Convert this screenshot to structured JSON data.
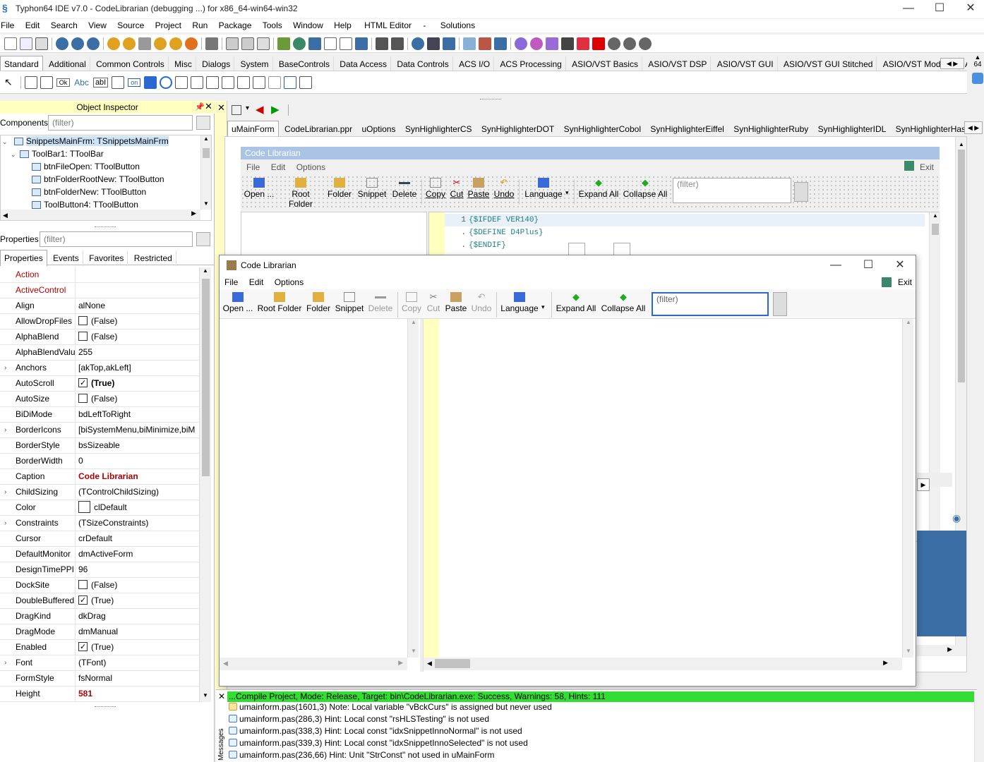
{
  "window": {
    "title": "Typhon64 IDE v7.0 - CodeLibrarian (debugging ...) for x86_64-win64-win32",
    "controls": [
      "—",
      "☐",
      "✕"
    ]
  },
  "mainmenu": [
    "File",
    "Edit",
    "Search",
    "View",
    "Source",
    "Project",
    "Run",
    "Package",
    "Tools",
    "Window",
    "Help",
    "HTML Editor",
    "-",
    "Solutions"
  ],
  "palette_tabs": [
    "Standard",
    "Additional",
    "Common Controls",
    "Misc",
    "Dialogs",
    "System",
    "BaseControls",
    "Data Access",
    "Data Controls",
    "ACS I/O",
    "ACS Processing",
    "ASIO/VST Basics",
    "ASIO/VST DSP",
    "ASIO/VST GUI",
    "ASIO/VST GUI Stitched",
    "ASIO/VST Modular",
    "Abbrevi..."
  ],
  "palette_icons": {
    "ok": "Ok",
    "abc": "Abc",
    "abl": "abI",
    "on": "on"
  },
  "palette_side": {
    "label": "64"
  },
  "object_inspector": {
    "title": "Object Inspector",
    "components_label": "Components",
    "filter_placeholder": "(filter)",
    "tree": [
      {
        "label": "SnippetsMainFrm: TSnippetsMainFrm",
        "level": 0
      },
      {
        "label": "ToolBar1: TToolBar",
        "level": 1
      },
      {
        "label": "btnFileOpen: TToolButton",
        "level": 2
      },
      {
        "label": "btnFolderRootNew: TToolButton",
        "level": 2
      },
      {
        "label": "btnFolderNew: TToolButton",
        "level": 2
      },
      {
        "label": "ToolButton4: TToolButton",
        "level": 2
      }
    ],
    "properties_label": "Properties",
    "prop_tabs": [
      "Properties",
      "Events",
      "Favorites",
      "Restricted"
    ],
    "props": [
      {
        "name": "Action",
        "value": "",
        "red": true
      },
      {
        "name": "ActiveControl",
        "value": "",
        "red": true
      },
      {
        "name": "Align",
        "value": "alNone"
      },
      {
        "name": "AllowDropFiles",
        "value": "(False)",
        "check": "off"
      },
      {
        "name": "AlphaBlend",
        "value": "(False)",
        "check": "off"
      },
      {
        "name": "AlphaBlendValu",
        "value": "255"
      },
      {
        "name": "Anchors",
        "value": "[akTop,akLeft]",
        "expand": true
      },
      {
        "name": "AutoScroll",
        "value": "(True)",
        "check": "on",
        "bold": true
      },
      {
        "name": "AutoSize",
        "value": "(False)",
        "check": "off"
      },
      {
        "name": "BiDiMode",
        "value": "bdLeftToRight"
      },
      {
        "name": "BorderIcons",
        "value": "[biSystemMenu,biMinimize,biM",
        "expand": true
      },
      {
        "name": "BorderStyle",
        "value": "bsSizeable"
      },
      {
        "name": "BorderWidth",
        "value": "0"
      },
      {
        "name": "Caption",
        "value": "Code Librarian",
        "valred": true
      },
      {
        "name": "ChildSizing",
        "value": "(TControlChildSizing)",
        "expand": true
      },
      {
        "name": "Color",
        "value": "clDefault",
        "swatch": true
      },
      {
        "name": "Constraints",
        "value": "(TSizeConstraints)",
        "expand": true
      },
      {
        "name": "Cursor",
        "value": "crDefault"
      },
      {
        "name": "DefaultMonitor",
        "value": "dmActiveForm"
      },
      {
        "name": "DesignTimePPI",
        "value": "96"
      },
      {
        "name": "DockSite",
        "value": "(False)",
        "check": "off"
      },
      {
        "name": "DoubleBuffered",
        "value": "(True)",
        "check": "on"
      },
      {
        "name": "DragKind",
        "value": "dkDrag"
      },
      {
        "name": "DragMode",
        "value": "dmManual"
      },
      {
        "name": "Enabled",
        "value": "(True)",
        "check": "on"
      },
      {
        "name": "Font",
        "value": "(TFont)",
        "expand": true
      },
      {
        "name": "FormStyle",
        "value": "fsNormal"
      },
      {
        "name": "Height",
        "value": "581",
        "valred": true
      }
    ]
  },
  "editor_tabs": [
    "uMainForm",
    "CodeLibrarian.ppr",
    "uOptions",
    "SynHighlighterCS",
    "SynHighlighterDOT",
    "SynHighlighterCobol",
    "SynHighlighterEiffel",
    "SynHighlighterRuby",
    "SynHighlighterIDL",
    "SynHighlighterHask"
  ],
  "designer": {
    "caption": "Code Librarian",
    "menu": [
      "File",
      "Edit",
      "Options"
    ],
    "exit_label": "Exit",
    "toolbar": [
      "Open ...",
      "Root Folder",
      "Folder",
      "Snippet",
      "Delete",
      "Copy",
      "Cut",
      "Paste",
      "Undo",
      "Language",
      "Expand All",
      "Collapse All"
    ],
    "filter_placeholder": "(filter)",
    "code_lines": [
      "{$IFDEF VER140}",
      "{$DEFINE D4Plus}",
      "{$ENDIF}",
      ""
    ],
    "gutter": [
      "1",
      ".",
      ".",
      "."
    ]
  },
  "running_app": {
    "title": "Code Librarian",
    "menu": [
      "File",
      "Edit",
      "Options"
    ],
    "exit_label": "Exit",
    "toolbar": [
      {
        "label": "Open ...",
        "enabled": true
      },
      {
        "label": "Root Folder",
        "enabled": true
      },
      {
        "label": "Folder",
        "enabled": true
      },
      {
        "label": "Snippet",
        "enabled": true
      },
      {
        "label": "Delete",
        "enabled": false
      },
      {
        "label": "Copy",
        "enabled": false
      },
      {
        "label": "Cut",
        "enabled": false
      },
      {
        "label": "Paste",
        "enabled": true
      },
      {
        "label": "Undo",
        "enabled": false
      },
      {
        "label": "Language",
        "enabled": true
      },
      {
        "label": "Expand All",
        "enabled": true
      },
      {
        "label": "Collapse All",
        "enabled": true
      }
    ],
    "filter_placeholder": "(filter)"
  },
  "messages": {
    "side_label": "Messages",
    "header": "...Compile Project, Mode: Release, Target: bin\\CodeLibrarian.exe: Success, Warnings: 58, Hints: 111",
    "lines": [
      {
        "text": "umainform.pas(1601,3) Note: Local variable \"vBckCurs\" is assigned but never used",
        "icon": "folder"
      },
      {
        "text": "umainform.pas(286,3) Hint: Local const \"rsHLSTesting\" is not used",
        "icon": "hint"
      },
      {
        "text": "umainform.pas(338,3) Hint: Local const \"idxSnippetInnoNormal\" is not used",
        "icon": "hint"
      },
      {
        "text": "umainform.pas(339,3) Hint: Local const \"idxSnippetInnoSelected\" is not used",
        "icon": "hint"
      },
      {
        "text": "umainform.pas(236,66) Hint: Unit \"StrConst\" not used in uMainForm",
        "icon": "hint"
      }
    ]
  },
  "colors": {
    "accent": "#3a6ea5",
    "success": "#33dd33",
    "caption_blue": "#aac4e6",
    "gutter_yellow": "#ffffc0"
  }
}
